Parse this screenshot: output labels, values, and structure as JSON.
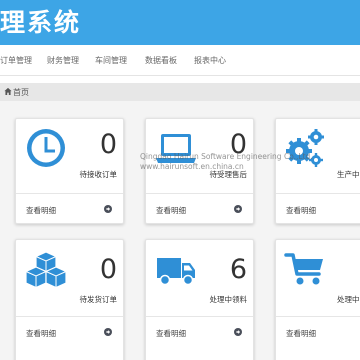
{
  "header": {
    "title": "理系统"
  },
  "nav": {
    "items": [
      "订单管理",
      "财务管理",
      "车间管理",
      "数据看板",
      "报表中心"
    ]
  },
  "breadcrumb": {
    "home": "首页"
  },
  "cards": [
    {
      "count": "0",
      "label": "待接收订单",
      "link": "查看明细",
      "icon": "clock-icon"
    },
    {
      "count": "0",
      "label": "待受理售后",
      "link": "查看明细",
      "icon": "laptop-icon"
    },
    {
      "count": "",
      "label": "生产中",
      "link": "查看明细",
      "icon": "gears-icon"
    },
    {
      "count": "0",
      "label": "待发货订单",
      "link": "查看明细",
      "icon": "cubes-icon"
    },
    {
      "count": "6",
      "label": "处理中领料",
      "link": "查看明细",
      "icon": "truck-icon"
    },
    {
      "count": "",
      "label": "处理中",
      "link": "查看明细",
      "icon": "cart-icon"
    }
  ],
  "watermark": {
    "line1": "Qingdao Hairun Software Engineering Co.,Ltd.",
    "line2": "www.hairunsoft.en.china.cn"
  },
  "colors": {
    "header": "#3da5e6",
    "icon": "#2f8fd6",
    "background": "#f4f4f4"
  }
}
